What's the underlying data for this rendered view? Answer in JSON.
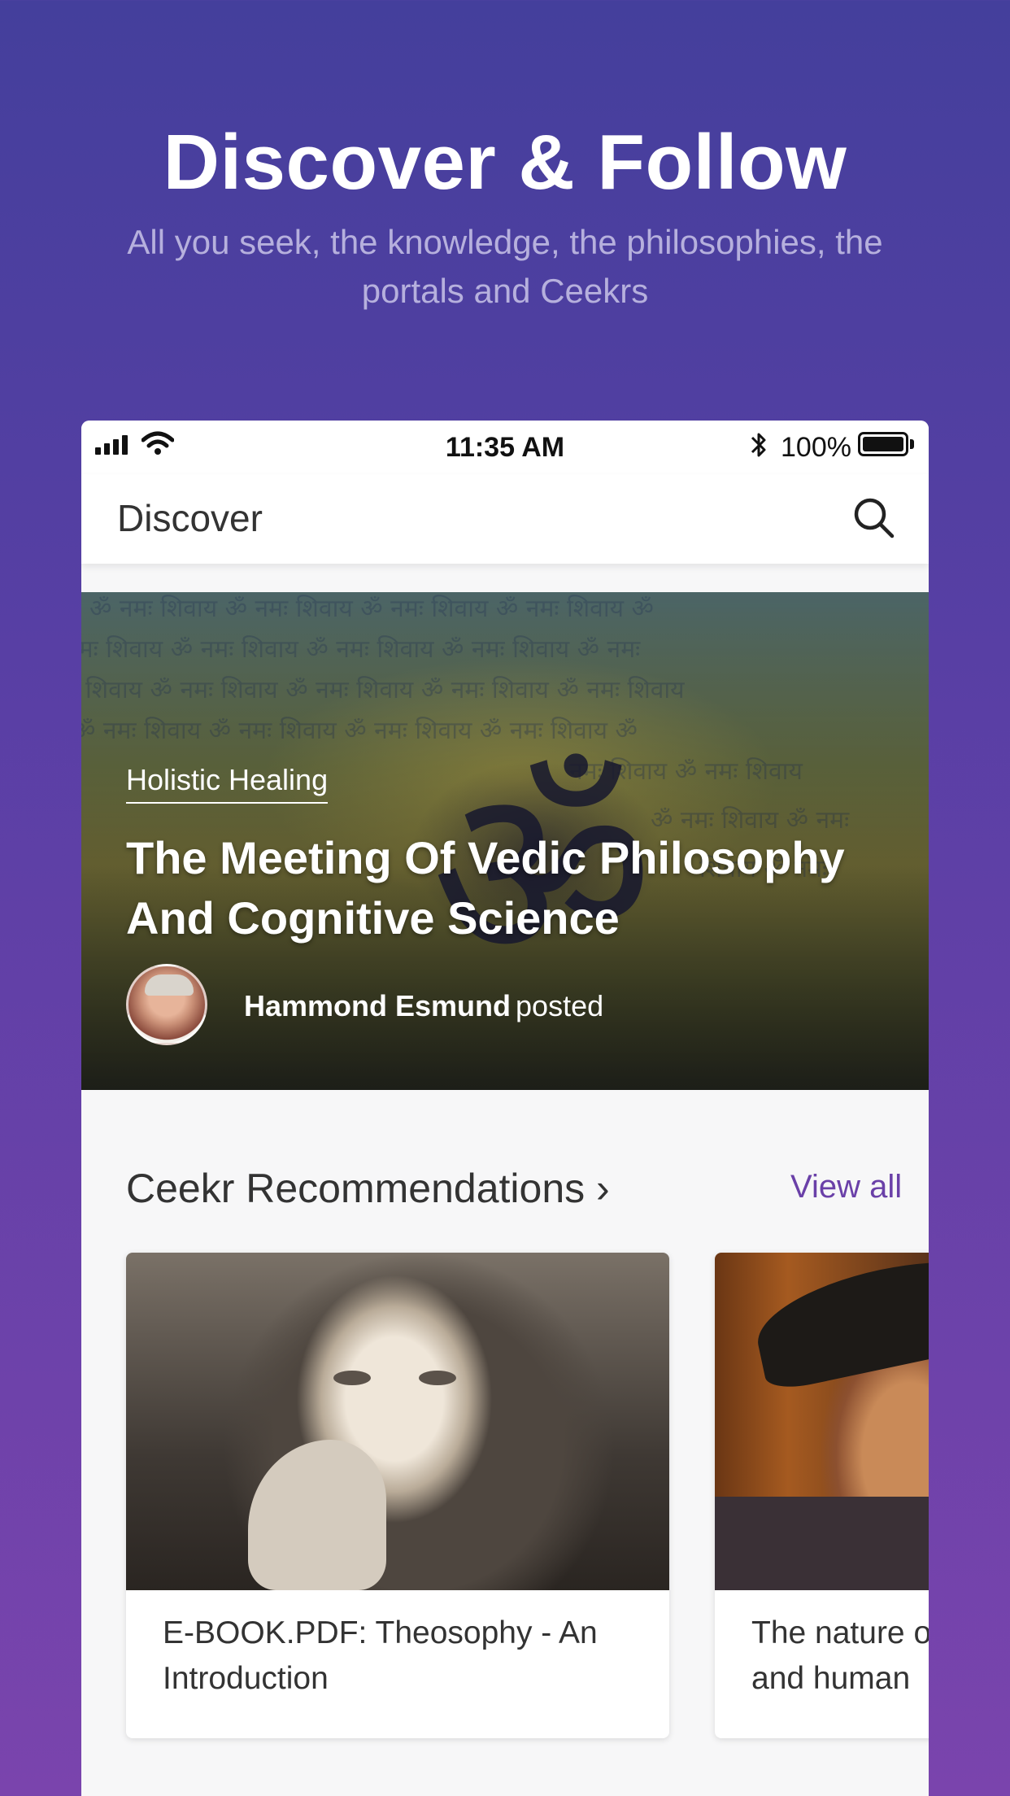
{
  "promo": {
    "title": "Discover & Follow",
    "subtitle": "All you seek, the knowledge, the philosophies, the portals and Ceekrs"
  },
  "statusbar": {
    "time": "11:35 AM",
    "battery": "100%"
  },
  "navbar": {
    "title": "Discover",
    "search_icon": "search-icon"
  },
  "hero": {
    "category": "Holistic Healing",
    "title": "The Meeting Of Vedic Philosophy And Cognitive Science",
    "author": "Hammond Esmund",
    "action": "posted"
  },
  "recommendations": {
    "title": "Ceekr Recommendations ›",
    "view_all": "View all",
    "cards": [
      {
        "text": "E-BOOK.PDF: Theosophy - An Introduction"
      },
      {
        "text_line1": "The nature o",
        "text_line2": "and human"
      }
    ]
  },
  "colors": {
    "accent": "#6a40a8",
    "background_top": "#443f9c",
    "background_bottom": "#7a44ad"
  }
}
